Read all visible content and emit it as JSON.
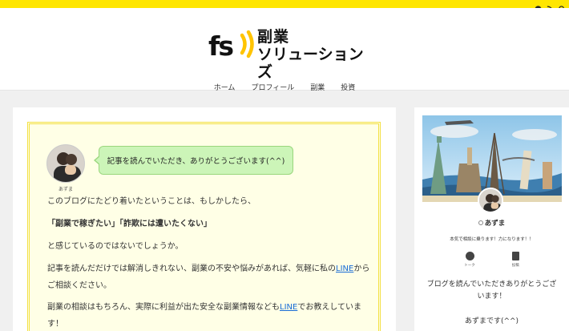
{
  "colors": {
    "accent": "#ffe600",
    "bubble": "#ccf5b8",
    "notice_bg": "#ffffe6",
    "link": "#1a6dd6"
  },
  "topbar": {
    "icons": [
      "pinterest-icon",
      "rss-icon",
      "search-icon"
    ]
  },
  "site": {
    "logo_mark": "fs",
    "logo_line1": "副業",
    "logo_line2": "ソリューションズ"
  },
  "nav": {
    "items": [
      "ホーム",
      "プロフィール",
      "副業",
      "投資"
    ]
  },
  "main": {
    "author_name": "あずま",
    "bubble_text": "記事を読んでいただき、ありがとうございます(^^)",
    "p1": "このブログにたどり着いたということは、もしかしたら、",
    "p2": "「副業で稼ぎたい」「詐欺には遭いたくない」",
    "p3": "と感じているのではないでしょうか。",
    "p4_pre": "記事を読んだだけでは解消しきれない、副業の不安や悩みがあれば、気軽に私の",
    "p4_link": "LINE",
    "p4_post": "から",
    "p4_line2": "ご相談ください。",
    "p5_pre": "副業の相談はもちろん、実際に利益が出た安全な副業情報なども",
    "p5_link": "LINE",
    "p5_post": "でお教えしていま",
    "p5_line2": "す！"
  },
  "sidebar": {
    "name": "あずま",
    "desc": "本気で相談に乗ります！力になります！！",
    "btn_talk": "トーク",
    "btn_post": "投稿",
    "p1": "ブログを読んでいただきありがとうございます！",
    "p2": "あずまです(^^)"
  }
}
